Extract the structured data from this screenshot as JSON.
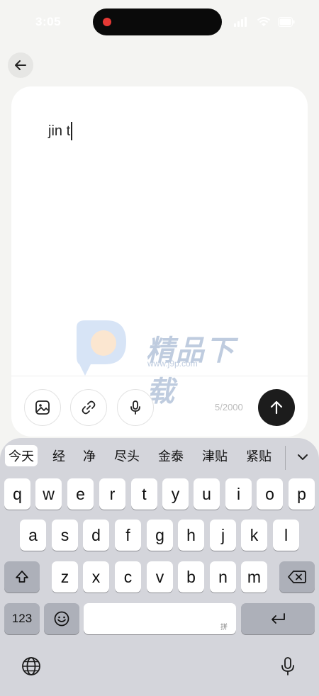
{
  "status_bar": {
    "time": "3:05"
  },
  "editor": {
    "text": "jin t"
  },
  "watermark": {
    "title": "精品下载",
    "url": "www.j9p.com"
  },
  "toolbar": {
    "char_count": "5/2000"
  },
  "keyboard": {
    "candidates": [
      "今天",
      "经",
      "净",
      "尽头",
      "金泰",
      "津贴",
      "紧贴"
    ],
    "row1": [
      "q",
      "w",
      "e",
      "r",
      "t",
      "y",
      "u",
      "i",
      "o",
      "p"
    ],
    "row2": [
      "a",
      "s",
      "d",
      "f",
      "g",
      "h",
      "j",
      "k",
      "l"
    ],
    "row3": [
      "z",
      "x",
      "c",
      "v",
      "b",
      "n",
      "m"
    ],
    "numbers_label": "123",
    "space_hint": "拼"
  },
  "colors": {
    "send_button": "#1c1c1c",
    "keyboard_bg": "#d4d5db",
    "recording_dot": "#e53935"
  }
}
